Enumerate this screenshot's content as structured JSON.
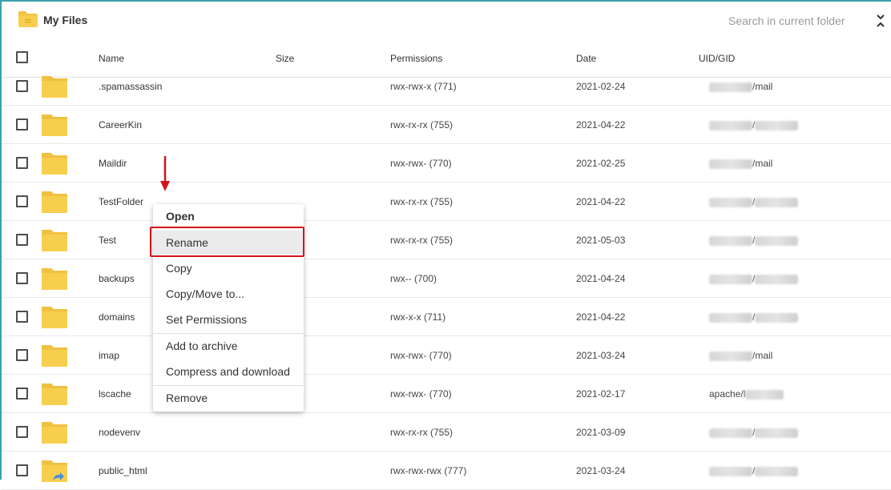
{
  "header": {
    "title": "My Files",
    "search_placeholder": "Search in current folder"
  },
  "columns": {
    "name": "Name",
    "size": "Size",
    "permissions": "Permissions",
    "date": "Date",
    "uid_gid": "UID/GID"
  },
  "rows": [
    {
      "name": ".spamassassin",
      "permissions": "rwx-rwx-x (771)",
      "date": "2021-02-24",
      "uid_gid": "/mail"
    },
    {
      "name": "CareerKin",
      "permissions": "rwx-rx-rx (755)",
      "date": "2021-04-22",
      "uid_gid": "/"
    },
    {
      "name": "Maildir",
      "permissions": "rwx-rwx- (770)",
      "date": "2021-02-25",
      "uid_gid": "/mail"
    },
    {
      "name": "TestFolder",
      "permissions": "rwx-rx-rx (755)",
      "date": "2021-04-22",
      "uid_gid": "/"
    },
    {
      "name": "Test",
      "permissions": "rwx-rx-rx (755)",
      "date": "2021-05-03",
      "uid_gid": "/"
    },
    {
      "name": "backups",
      "permissions": "rwx-- (700)",
      "date": "2021-04-24",
      "uid_gid": "/"
    },
    {
      "name": "domains",
      "permissions": "rwx-x-x (711)",
      "date": "2021-04-22",
      "uid_gid": "/"
    },
    {
      "name": "imap",
      "permissions": "rwx-rwx- (770)",
      "date": "2021-03-24",
      "uid_gid": "/mail"
    },
    {
      "name": "lscache",
      "permissions": "rwx-rwx- (770)",
      "date": "2021-02-17",
      "uid_gid": "apache/l"
    },
    {
      "name": "nodevenv",
      "permissions": "rwx-rx-rx (755)",
      "date": "2021-03-09",
      "uid_gid": "/"
    },
    {
      "name": "public_html",
      "permissions": "rwx-rwx-rwx (777)",
      "date": "2021-03-24",
      "uid_gid": "/"
    }
  ],
  "context_menu": {
    "open": "Open",
    "rename": "Rename",
    "copy": "Copy",
    "copy_move": "Copy/Move to...",
    "set_permissions": "Set Permissions",
    "add_to_archive": "Add to archive",
    "compress_download": "Compress and download",
    "remove": "Remove"
  },
  "colors": {
    "folder": "#f7cf4f",
    "highlight_border": "#d4141b",
    "arrow": "#d4141b"
  }
}
